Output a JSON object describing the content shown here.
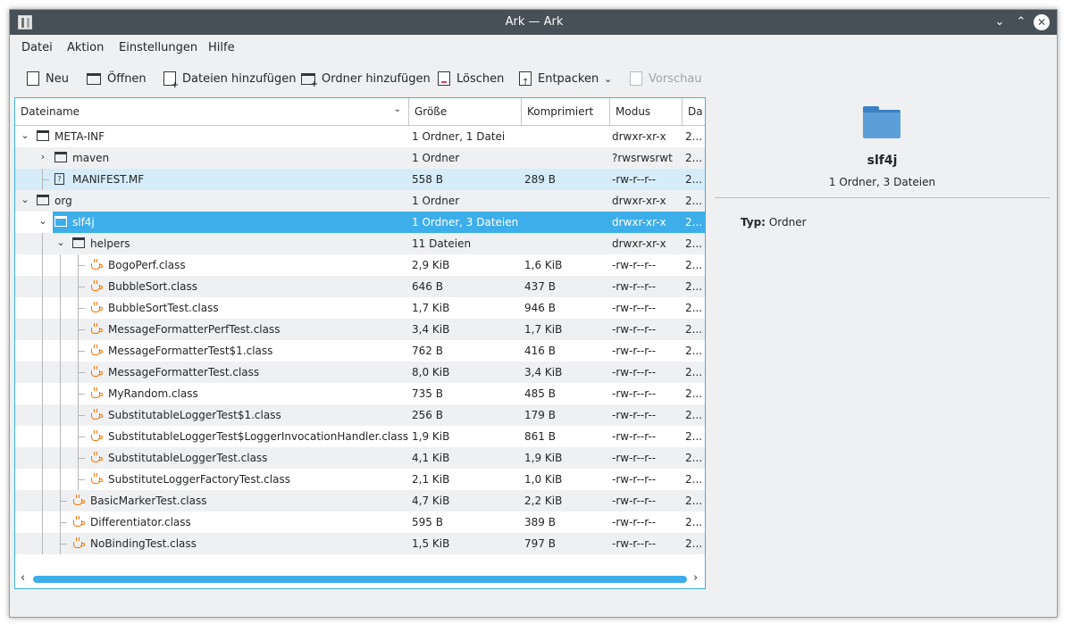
{
  "window": {
    "title": "Ark — Ark"
  },
  "menu": [
    "Datei",
    "Aktion",
    "Einstellungen",
    "Hilfe"
  ],
  "toolbar": {
    "new": "Neu",
    "open": "Öffnen",
    "add_files": "Dateien hinzufügen",
    "add_folder": "Ordner hinzufügen",
    "delete": "Löschen",
    "extract": "Entpacken",
    "preview": "Vorschau"
  },
  "columns": {
    "name": "Dateiname",
    "size": "Größe",
    "compressed": "Komprimiert",
    "mode": "Modus",
    "date": "Da"
  },
  "rows": [
    {
      "name": "META-INF",
      "size": "1 Ordner, 1 Datei",
      "compressed": "",
      "mode": "drwxr-xr-x",
      "date": "2..."
    },
    {
      "name": "maven",
      "size": "1 Ordner",
      "compressed": "",
      "mode": "?rwsrwsrwt",
      "date": "2..."
    },
    {
      "name": "MANIFEST.MF",
      "size": "558 B",
      "compressed": "289 B",
      "mode": "-rw-r--r--",
      "date": "2..."
    },
    {
      "name": "org",
      "size": "1 Ordner",
      "compressed": "",
      "mode": "drwxr-xr-x",
      "date": "2..."
    },
    {
      "name": "slf4j",
      "size": "1 Ordner, 3 Dateien",
      "compressed": "",
      "mode": "drwxr-xr-x",
      "date": "2..."
    },
    {
      "name": "helpers",
      "size": "11 Dateien",
      "compressed": "",
      "mode": "drwxr-xr-x",
      "date": "2..."
    },
    {
      "name": "BogoPerf.class",
      "size": "2,9 KiB",
      "compressed": "1,6 KiB",
      "mode": "-rw-r--r--",
      "date": "2..."
    },
    {
      "name": "BubbleSort.class",
      "size": "646 B",
      "compressed": "437 B",
      "mode": "-rw-r--r--",
      "date": "2..."
    },
    {
      "name": "BubbleSortTest.class",
      "size": "1,7 KiB",
      "compressed": "946 B",
      "mode": "-rw-r--r--",
      "date": "2..."
    },
    {
      "name": "MessageFormatterPerfTest.class",
      "size": "3,4 KiB",
      "compressed": "1,7 KiB",
      "mode": "-rw-r--r--",
      "date": "2..."
    },
    {
      "name": "MessageFormatterTest$1.class",
      "size": "762 B",
      "compressed": "416 B",
      "mode": "-rw-r--r--",
      "date": "2..."
    },
    {
      "name": "MessageFormatterTest.class",
      "size": "8,0 KiB",
      "compressed": "3,4 KiB",
      "mode": "-rw-r--r--",
      "date": "2..."
    },
    {
      "name": "MyRandom.class",
      "size": "735 B",
      "compressed": "485 B",
      "mode": "-rw-r--r--",
      "date": "2..."
    },
    {
      "name": "SubstitutableLoggerTest$1.class",
      "size": "256 B",
      "compressed": "179 B",
      "mode": "-rw-r--r--",
      "date": "2..."
    },
    {
      "name": "SubstitutableLoggerTest$LoggerInvocationHandler.class",
      "size": "1,9 KiB",
      "compressed": "861 B",
      "mode": "-rw-r--r--",
      "date": "2..."
    },
    {
      "name": "SubstitutableLoggerTest.class",
      "size": "4,1 KiB",
      "compressed": "1,9 KiB",
      "mode": "-rw-r--r--",
      "date": "2..."
    },
    {
      "name": "SubstituteLoggerFactoryTest.class",
      "size": "2,1 KiB",
      "compressed": "1,0 KiB",
      "mode": "-rw-r--r--",
      "date": "2..."
    },
    {
      "name": "BasicMarkerTest.class",
      "size": "4,7 KiB",
      "compressed": "2,2 KiB",
      "mode": "-rw-r--r--",
      "date": "2..."
    },
    {
      "name": "Differentiator.class",
      "size": "595 B",
      "compressed": "389 B",
      "mode": "-rw-r--r--",
      "date": "2..."
    },
    {
      "name": "NoBindingTest.class",
      "size": "1,5 KiB",
      "compressed": "797 B",
      "mode": "-rw-r--r--",
      "date": "2..."
    }
  ],
  "details": {
    "name": "slf4j",
    "summary": "1 Ordner, 3 Dateien",
    "type_label": "Typ:",
    "type_value": "Ordner"
  }
}
